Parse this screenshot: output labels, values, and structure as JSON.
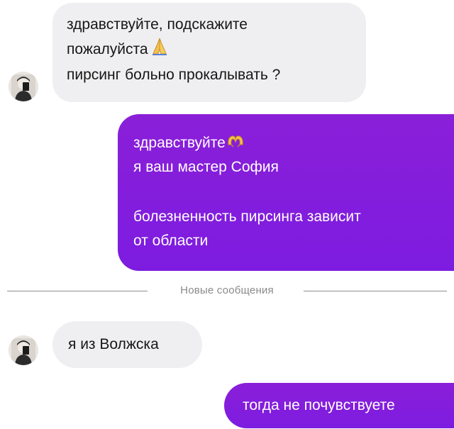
{
  "conversation": {
    "incoming_1": {
      "lines": [
        "здравствуйте, подскажите",
        "пожалуйста",
        "пирсинг больно прокалывать ?"
      ],
      "emoji": "folded-hands-icon"
    },
    "outgoing_1": {
      "lines": [
        "здравствуйте",
        "я ваш мастер София",
        "болезненность пирсинга зависит",
        "от области"
      ],
      "emoji": "heart-hands-icon"
    },
    "divider_label": "Новые сообщения",
    "incoming_2": {
      "text": "я из Волжска"
    },
    "outgoing_2": {
      "text": "тогда не почувствуете"
    }
  },
  "colors": {
    "incoming_bubble": "#efeff1",
    "outgoing_bubble": "#8a1fd8",
    "divider_text": "#8a8a8a"
  }
}
